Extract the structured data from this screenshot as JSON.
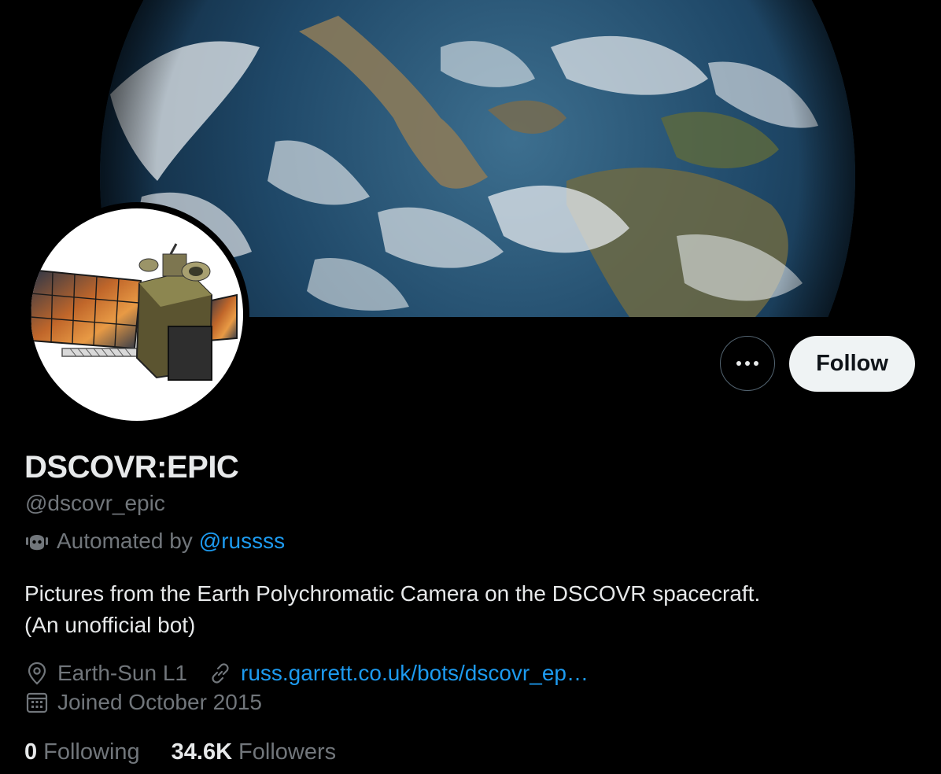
{
  "profile": {
    "name": "DSCOVR:EPIC",
    "handle": "@dscovr_epic",
    "automated_prefix": "Automated by",
    "automated_link": "@russss",
    "bio_line1": "Pictures from the Earth Polychromatic Camera on the DSCOVR spacecraft.",
    "bio_line2": "(An unofficial bot)",
    "location": "Earth-Sun L1",
    "website": "russ.garrett.co.uk/bots/dscovr_ep…",
    "joined": "Joined October 2015"
  },
  "actions": {
    "follow_label": "Follow"
  },
  "stats": {
    "following_count": "0",
    "following_label": "Following",
    "followers_count": "34.6K",
    "followers_label": "Followers"
  },
  "icons": {
    "more": "more-icon",
    "robot": "robot-icon",
    "location": "location-pin-icon",
    "website": "link-icon",
    "joined": "calendar-icon"
  },
  "colors": {
    "background": "#000000",
    "text_primary": "#e7e9ea",
    "text_secondary": "#71767b",
    "link": "#1d9bf0",
    "follow_button_bg": "#eff3f4"
  }
}
